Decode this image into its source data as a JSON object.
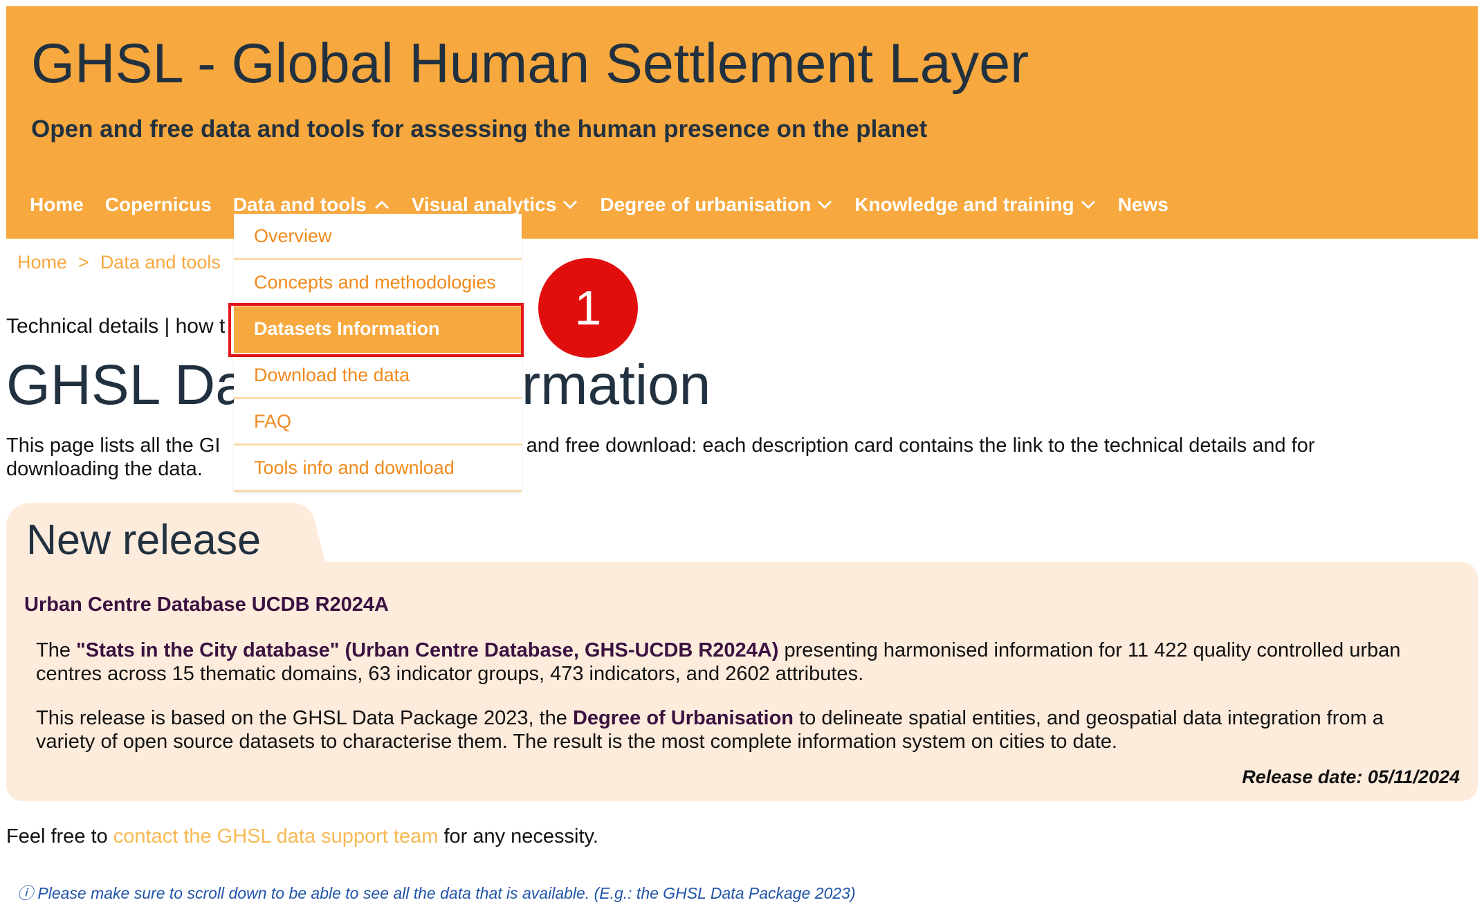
{
  "header": {
    "title": "GHSL - Global Human Settlement Layer",
    "subtitle": "Open and free data and tools for assessing the human presence on the planet",
    "nav": [
      {
        "label": "Home",
        "has_chevron": false
      },
      {
        "label": "Copernicus",
        "has_chevron": false
      },
      {
        "label": "Data and tools",
        "has_chevron": true,
        "expanded": true
      },
      {
        "label": "Visual analytics",
        "has_chevron": true
      },
      {
        "label": "Degree of urbanisation",
        "has_chevron": true
      },
      {
        "label": "Knowledge and training",
        "has_chevron": true
      },
      {
        "label": "News",
        "has_chevron": false
      }
    ]
  },
  "dropdown": {
    "items": [
      {
        "label": "Overview"
      },
      {
        "label": "Concepts and methodologies"
      },
      {
        "label": "Datasets Information",
        "selected": true
      },
      {
        "label": "Download the data"
      },
      {
        "label": "FAQ"
      },
      {
        "label": "Tools info and download"
      }
    ]
  },
  "annotation": {
    "step": "1",
    "color": "#e10e0e"
  },
  "breadcrumb": {
    "home": "Home",
    "separator": ">",
    "current": "Data and tools"
  },
  "main": {
    "tech_line": "Technical details | how t",
    "page_title_start": "GHSL Da",
    "page_title_end": "rmation",
    "intro_line1_start": "This page lists all the GI",
    "intro_line1_end": "n and free download: each description card contains the link to the technical details and for",
    "intro_line2": "downloading the data."
  },
  "release": {
    "heading": "New release",
    "title": "Urban Centre Database UCDB R2024A",
    "p1_pre": "The ",
    "p1_link": "\"Stats in the City database\" (Urban Centre Database, GHS-UCDB R2024A)",
    "p1_post": " presenting harmonised information for 11 422 quality controlled urban centres across 15 thematic domains, 63 indicator groups, 473 indicators, and 2602 attributes.",
    "p2_pre": "This release is based on the GHSL Data Package 2023, the ",
    "p2_link": "Degree of Urbanisation",
    "p2_post": " to delineate spatial entities, and geospatial data integration from a variety of open source datasets to characterise them. The result is the most complete information system on cities to date.",
    "date": "Release date: 05/11/2024"
  },
  "contact": {
    "pre": "Feel free to ",
    "link": "contact the GHSL data support team",
    "post": " for any necessity."
  },
  "note": "ⓘ Please make sure to scroll down to be able to see all the data that is available. (E.g.: the GHSL Data Package 2023)",
  "colors": {
    "header_bg": "#f7a83e",
    "title_text": "#22313f",
    "link_orange": "#f08a1c",
    "card_bg": "#fdebdc",
    "highlight_border": "#e2141b"
  }
}
